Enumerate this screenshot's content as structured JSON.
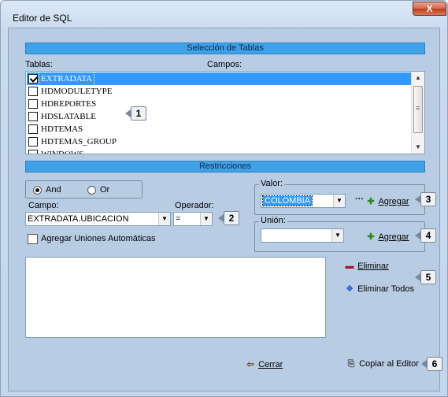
{
  "window": {
    "title": "Editor de SQL",
    "close": "X"
  },
  "tables_section": {
    "header": "Selección de Tablas",
    "tables_label": "Tablas:",
    "fields_label": "Campos:",
    "tables": [
      {
        "name": "EXTRADATA",
        "checked": true,
        "selected": true
      },
      {
        "name": "HDMODULETYPE",
        "checked": false,
        "selected": false
      },
      {
        "name": "HDREPORTES",
        "checked": false,
        "selected": false
      },
      {
        "name": "HDSLATABLE",
        "checked": false,
        "selected": false
      },
      {
        "name": "HDTEMAS",
        "checked": false,
        "selected": false
      },
      {
        "name": "HDTEMAS_GROUP",
        "checked": false,
        "selected": false
      },
      {
        "name": "WINDOWS",
        "checked": false,
        "selected": false
      }
    ]
  },
  "restrictions_section": {
    "header": "Restricciones",
    "logic": {
      "and_label": "And",
      "or_label": "Or",
      "selected": "And"
    },
    "field_label": "Campo:",
    "field_value": "EXTRADATA.UBICACION",
    "operator_label": "Operador:",
    "operator_value": "=",
    "auto_joins_label": "Agregar Uniones Automáticas",
    "value_group_label": "Valor:",
    "value_value": "COLOMBIA",
    "value_more": "···",
    "value_add_label": "Agregar",
    "union_group_label": "Unión:",
    "union_value": "",
    "union_add_label": "Agregar",
    "delete_label": "Eliminar",
    "delete_all_label": "Eliminar Todos"
  },
  "footer": {
    "close_label": "Cerrar",
    "copy_label": "Copiar al Editor"
  },
  "callouts": [
    "1",
    "2",
    "3",
    "4",
    "5",
    "6"
  ],
  "icons": {
    "add": "green-plus-icon",
    "delete": "red-minus-icon",
    "delete_all": "multicolor-delete-all-icon",
    "close": "exit-door-icon",
    "copy": "copy-to-editor-icon"
  },
  "colors": {
    "section_bar": "#3fa2e8",
    "client_bg": "#b8cde4",
    "selection": "#3399ff"
  }
}
